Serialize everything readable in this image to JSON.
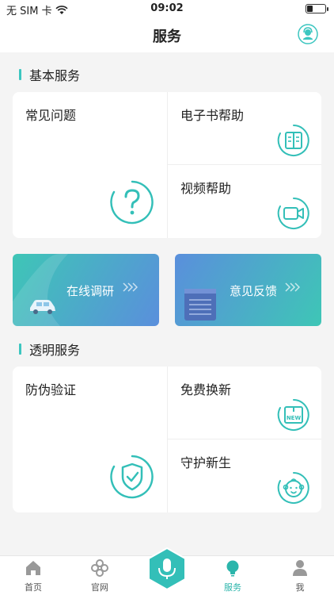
{
  "status_bar": {
    "carrier": "无 SIM 卡",
    "time": "09:02",
    "battery_level": 0.3
  },
  "header": {
    "title": "服务"
  },
  "sections": [
    {
      "title": "基本服务",
      "cards": [
        {
          "label": "常见问题",
          "icon": "question-icon"
        },
        {
          "label": "电子书帮助",
          "icon": "book-icon"
        },
        {
          "label": "视频帮助",
          "icon": "video-camera-icon"
        }
      ]
    },
    {
      "title": "透明服务",
      "cards": [
        {
          "label": "防伪验证",
          "icon": "shield-check-icon"
        },
        {
          "label": "免费换新",
          "icon": "new-box-icon"
        },
        {
          "label": "守护新生",
          "icon": "baby-face-icon"
        }
      ]
    }
  ],
  "promos": [
    {
      "label": "在线调研",
      "icon": "car-icon"
    },
    {
      "label": "意见反馈",
      "icon": "notepad-icon"
    }
  ],
  "tab_bar": {
    "tabs": [
      {
        "label": "首页",
        "icon": "home-icon"
      },
      {
        "label": "官网",
        "icon": "flower-icon"
      },
      {
        "label": "",
        "icon": "microphone-icon"
      },
      {
        "label": "服务",
        "icon": "lightbulb-icon"
      },
      {
        "label": "我",
        "icon": "person-icon"
      }
    ],
    "active_tab": "服务"
  },
  "colors": {
    "accent": "#2bb5ab",
    "promo_left_from": "#3ec6b6",
    "promo_left_to": "#5a8fdc",
    "promo_right_from": "#5a8fdc",
    "promo_right_to": "#3ec6b6"
  }
}
